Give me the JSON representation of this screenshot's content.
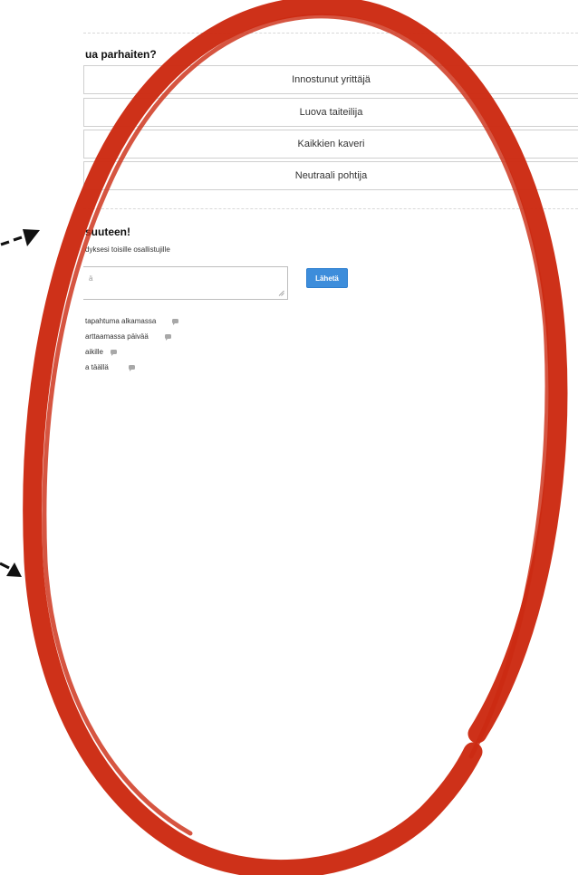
{
  "poll": {
    "question": "ua parhaiten?",
    "options": [
      {
        "label": "Innostunut yrittäjä"
      },
      {
        "label": "Luova taiteilija"
      },
      {
        "label": "Kaikkien kaveri"
      },
      {
        "label": "Neutraali pohtija"
      }
    ]
  },
  "comments": {
    "title": "suuteen!",
    "description": "dyksesi toisille osallistujille",
    "input_value": "ä",
    "send_label": "Lähetä",
    "items": [
      {
        "text": "tapahtuma alkamassa"
      },
      {
        "text": "arttaamassa päivää"
      },
      {
        "text": "aikille"
      },
      {
        "text": "a täällä"
      }
    ]
  },
  "colors": {
    "annotation_red": "#cc2a12",
    "arrow": "#111111",
    "button_blue": "#3d8ddb"
  }
}
